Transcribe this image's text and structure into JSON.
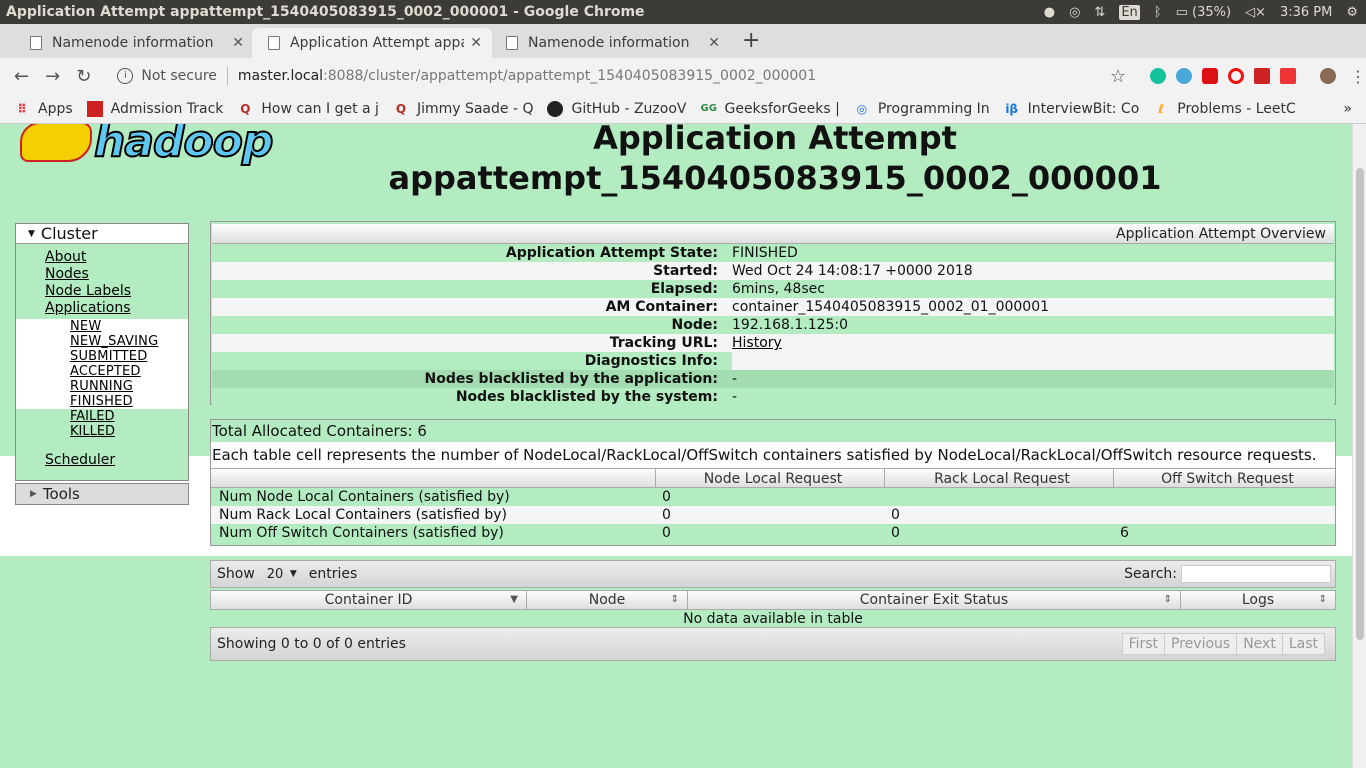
{
  "os": {
    "window_title": "Application Attempt appattempt_1540405083915_0002_000001 - Google Chrome",
    "keyboard": "En",
    "battery": "(35%)",
    "time": "3:36 PM"
  },
  "tabs": [
    {
      "label": "Namenode information",
      "active": false
    },
    {
      "label": "Application Attempt appa",
      "active": true
    },
    {
      "label": "Namenode information",
      "active": false
    }
  ],
  "address": {
    "security": "Not secure",
    "host": "master.local",
    "path": ":8088/cluster/appattempt/appattempt_1540405083915_0002_000001"
  },
  "bookmarks": [
    {
      "label": "Apps",
      "icon": "apps-grid-icon"
    },
    {
      "label": "Admission Track",
      "icon": "bookmark-icon"
    },
    {
      "label": "How can I get a j",
      "icon": "quora-icon"
    },
    {
      "label": "Jimmy Saade - Q",
      "icon": "quora-icon"
    },
    {
      "label": "GitHub - ZuzooV",
      "icon": "github-icon"
    },
    {
      "label": "GeeksforGeeks |",
      "icon": "gfg-icon"
    },
    {
      "label": "Programming In",
      "icon": "programming-icon"
    },
    {
      "label": "InterviewBit: Co",
      "icon": "interviewbit-icon"
    },
    {
      "label": "Problems - LeetC",
      "icon": "leetcode-icon"
    }
  ],
  "page": {
    "title_line1": "Application Attempt",
    "title_line2": "appattempt_1540405083915_0002_000001",
    "logo_text": "hadoop"
  },
  "nav": {
    "cluster_label": "Cluster",
    "links": [
      "About",
      "Nodes",
      "Node Labels",
      "Applications"
    ],
    "app_states_white": [
      "NEW",
      "NEW_SAVING",
      "SUBMITTED",
      "ACCEPTED",
      "RUNNING",
      "FINISHED"
    ],
    "app_states_green": [
      "FAILED",
      "KILLED"
    ],
    "scheduler": "Scheduler",
    "tools_label": "Tools"
  },
  "overview": {
    "header": "Application Attempt Overview",
    "rows": [
      {
        "label": "Application Attempt State:",
        "value": "FINISHED"
      },
      {
        "label": "Started:",
        "value": "Wed Oct 24 14:08:17 +0000 2018"
      },
      {
        "label": "Elapsed:",
        "value": "6mins, 48sec"
      },
      {
        "label": "AM Container:",
        "value": "container_1540405083915_0002_01_000001"
      },
      {
        "label": "Node:",
        "value": "192.168.1.125:0"
      },
      {
        "label": "Tracking URL:",
        "value": "History"
      },
      {
        "label": "Diagnostics Info:",
        "value": ""
      },
      {
        "label": "Nodes blacklisted by the application:",
        "value": "-"
      },
      {
        "label": "Nodes blacklisted by the system:",
        "value": "-"
      }
    ]
  },
  "allocation": {
    "total": "Total Allocated Containers: 6",
    "description": "Each table cell represents the number of NodeLocal/RackLocal/OffSwitch containers satisfied by NodeLocal/RackLocal/OffSwitch resource requests.",
    "columns": [
      "",
      "Node Local Request",
      "Rack Local Request",
      "Off Switch Request"
    ],
    "rows": [
      [
        "Num Node Local Containers (satisfied by)",
        "0",
        "",
        ""
      ],
      [
        "Num Rack Local Containers (satisfied by)",
        "0",
        "0",
        ""
      ],
      [
        "Num Off Switch Containers (satisfied by)",
        "0",
        "0",
        "6"
      ]
    ]
  },
  "datatable": {
    "show_label": "Show",
    "page_size": "20",
    "entries_label": "entries",
    "search_label": "Search:",
    "columns": [
      "Container ID",
      "Node",
      "Container Exit Status",
      "Logs"
    ],
    "empty_text": "No data available in table",
    "info": "Showing 0 to 0 of 0 entries",
    "pager": [
      "First",
      "Previous",
      "Next",
      "Last"
    ]
  }
}
